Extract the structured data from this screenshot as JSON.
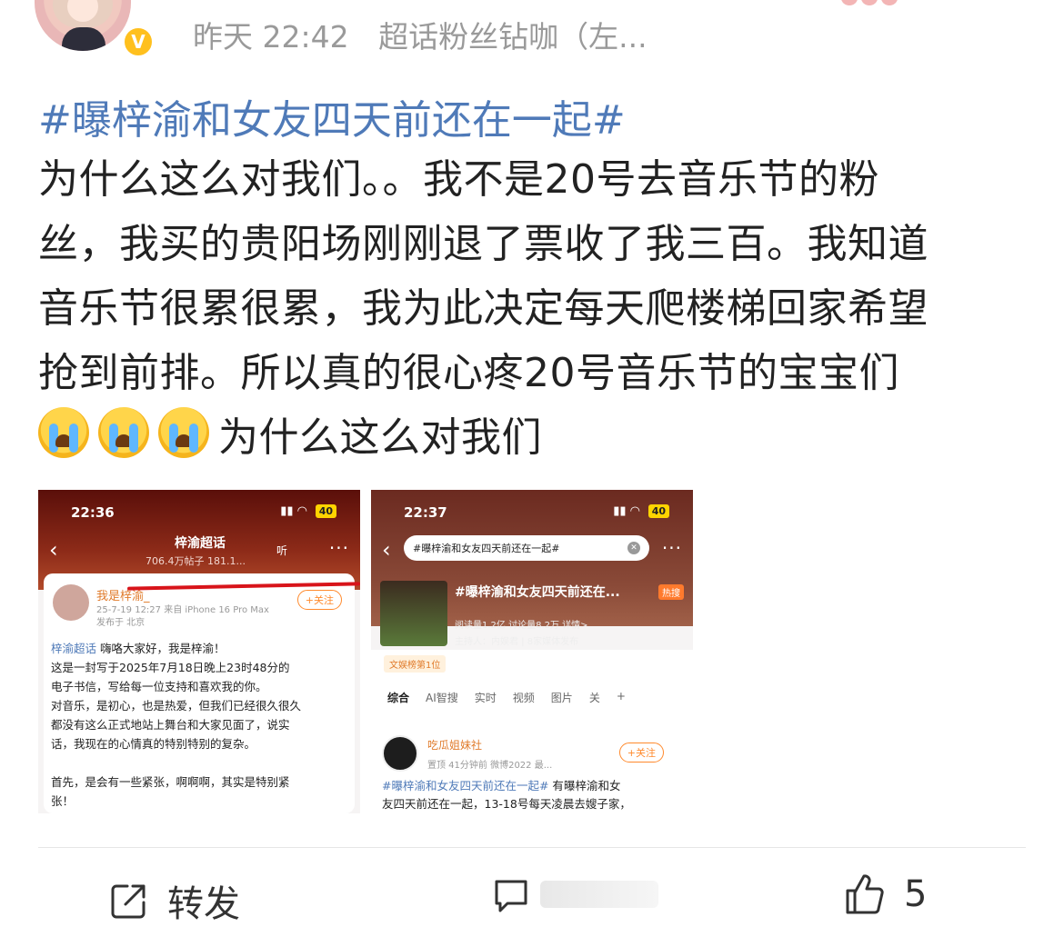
{
  "header": {
    "time": "昨天 22:42",
    "source": "超话粉丝钻咖（左..."
  },
  "post": {
    "topic": "#曝梓渝和女友四天前还在一起#",
    "lines": [
      "为什么这么对我们。。我不是20号去音乐节的粉",
      "丝，我买的贵阳场刚刚退了票收了我三百。我知道",
      "音乐节很累很累，我为此决定每天爬楼梯回家希望",
      "抢到前排。所以真的很心疼20号音乐节的宝宝们"
    ],
    "last_line": "为什么这么对我们"
  },
  "shot1": {
    "time": "22:36",
    "battery": "40",
    "title": "梓渝超话",
    "sub": "706.4万帖子 181.1...",
    "listen": "听",
    "user": "我是梓渝_",
    "follow": "+关注",
    "meta1": "25-7-19 12:27 来自 iPhone 16 Pro Max",
    "meta2": "发布于 北京",
    "tag": "梓渝超话",
    "text1": " 嗨咯大家好，我是梓渝！",
    "text2": "这是一封写于2025年7月18日晚上23时48分的",
    "text3": "电子书信，写给每一位支持和喜欢我的你。",
    "text4": "对音乐，是初心，也是热爱，但我们已经很久很久",
    "text5": "都没有这么正式地站上舞台和大家见面了，说实",
    "text6": "话，我现在的心情真的特别特别的复杂。",
    "text7": "首先，是会有一些紧张，啊啊啊，其实是特别紧",
    "text8": "张！"
  },
  "shot2": {
    "time": "22:37",
    "battery": "40",
    "search": "#曝梓渝和女友四天前还在一起#",
    "title": "#曝梓渝和女友四天前还在...",
    "hot": "热搜",
    "stats": "阅读量1.2亿  讨论量8.2万  详情>",
    "host": "主持人：内娱君 | 8家媒体发布",
    "rank": "文娱榜第1位",
    "tabs": [
      "综合",
      "AI智搜",
      "实时",
      "视频",
      "图片",
      "关",
      "+"
    ],
    "user": "吃瓜姐妹社",
    "meta": "置顶  41分钟前  微博2022 最...",
    "follow": "+关注",
    "tag": "#曝梓渝和女友四天前还在一起#",
    "text_a": " 有",
    "text_b": "曝梓渝和女",
    "text_c": "友四天前还在一起，13-18号每天凌晨去嫂子家，"
  },
  "footer": {
    "share": "转发",
    "likes": "5"
  },
  "colors": {
    "topic": "#4f7ab8",
    "meta": "#9a9a9a",
    "verified": "#ffc01e"
  }
}
